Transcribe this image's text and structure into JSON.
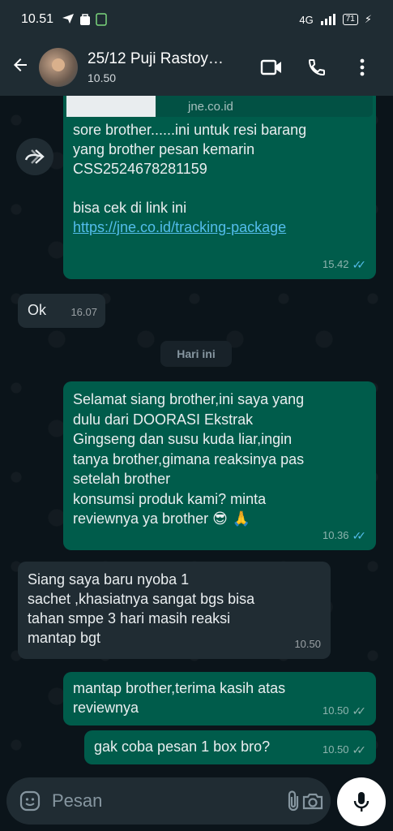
{
  "status_bar": {
    "time": "10.51",
    "network": "4G",
    "battery": "71"
  },
  "header": {
    "title": "25/12 Puji Rastoy…",
    "subtitle": "10.50"
  },
  "messages": {
    "m1": {
      "preview_domain": "jne.co.id",
      "line1": "sore brother......ini untuk resi barang",
      "line2": "yang brother pesan kemarin",
      "line3": "CSS2524678281159",
      "line4": "bisa cek di link ini",
      "link": "https://jne.co.id/tracking-package",
      "time": "15.42"
    },
    "m2": {
      "text": "Ok",
      "time": "16.07"
    },
    "date_chip": "Hari ini",
    "m3": {
      "line1": "Selamat siang brother,ini saya yang",
      "line2": "dulu dari  DOORASI Ekstrak",
      "line3": "Gingseng dan susu kuda liar,ingin",
      "line4": "tanya brother,gimana reaksinya pas",
      "line5": "setelah brother",
      "line6": "konsumsi produk kami? minta",
      "line7": "reviewnya ya brother",
      "emoji": "😎 🙏",
      "time": "10.36"
    },
    "m4": {
      "line1": "Siang saya baru nyoba 1",
      "line2": "sachet ,khasiatnya sangat bgs bisa",
      "line3": "tahan smpe 3 hari masih reaksi",
      "line4": "mantap bgt",
      "time": "10.50"
    },
    "m5": {
      "line1": "mantap brother,terima kasih atas",
      "line2": "reviewnya",
      "time": "10.50"
    },
    "m6": {
      "text": "gak coba pesan 1 box bro?",
      "time": "10.50"
    }
  },
  "input": {
    "placeholder": "Pesan"
  },
  "colors": {
    "outgoing": "#005c4b",
    "incoming": "#202c33",
    "read_tick": "#53bdeb",
    "background": "#0b141a",
    "header": "#1f2c33"
  },
  "icons": [
    "back-arrow-icon",
    "video-call-icon",
    "phone-icon",
    "more-icon",
    "forward-icon",
    "sticker-icon",
    "attach-icon",
    "camera-icon",
    "mic-icon"
  ]
}
